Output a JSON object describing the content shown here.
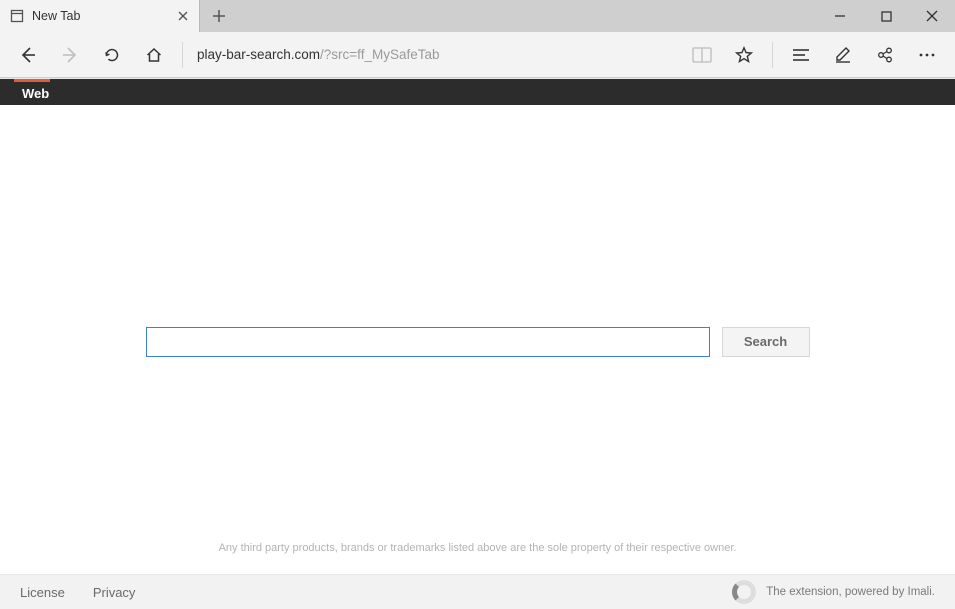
{
  "tab": {
    "title": "New Tab"
  },
  "url": {
    "host": "play-bar-search.com",
    "rest": "/?src=ff_MySafeTab"
  },
  "blackbar": {
    "web": "Web"
  },
  "search": {
    "placeholder": "",
    "value": "",
    "button": "Search"
  },
  "disclaimer": "Any third party products, brands or trademarks listed above are the sole property of their respective owner.",
  "footer": {
    "license": "License",
    "privacy": "Privacy",
    "powered": "The extension, powered by Imali."
  }
}
